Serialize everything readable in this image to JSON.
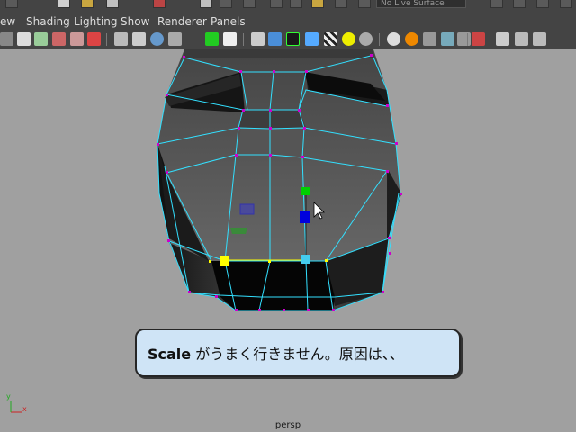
{
  "topbar": {
    "object_selector": "No Live Surface"
  },
  "menu": {
    "items": [
      "ew",
      "Shading",
      "Lighting",
      "Show",
      "Renderer",
      "Panels"
    ]
  },
  "toolbar": {
    "icons": [
      "select-camera-icon",
      "camera-attributes-icon",
      "bookmark-icon",
      "image-plane-icon",
      "grid-icon",
      "film-gate-icon",
      "resolution-gate-icon",
      "safe-action-icon",
      "field-chart-icon",
      "wireframe-icon",
      "smooth-shade-icon",
      "wireframe-on-shaded-icon",
      "default-material-icon",
      "checker-texture-icon",
      "default-lighting-icon",
      "shadows-icon",
      "hardware-texture-icon",
      "ambient-occlusion-icon",
      "isolate-select-icon",
      "xray-icon",
      "xray-joints-icon",
      "sidebar-toggle-icon"
    ]
  },
  "caption": {
    "bold": "Scale",
    "rest": " がうまく行きません。原因は、、"
  },
  "viewport": {
    "camera_label": "persp"
  },
  "axis": {
    "x": "x",
    "y": "y"
  },
  "colors": {
    "wire": "#33e0ff",
    "vertex": "#cc00cc",
    "manip_x": "#0000dd",
    "manip_y": "#00cc00",
    "manip_z": "#44ccee",
    "selected": "#ffff00"
  }
}
